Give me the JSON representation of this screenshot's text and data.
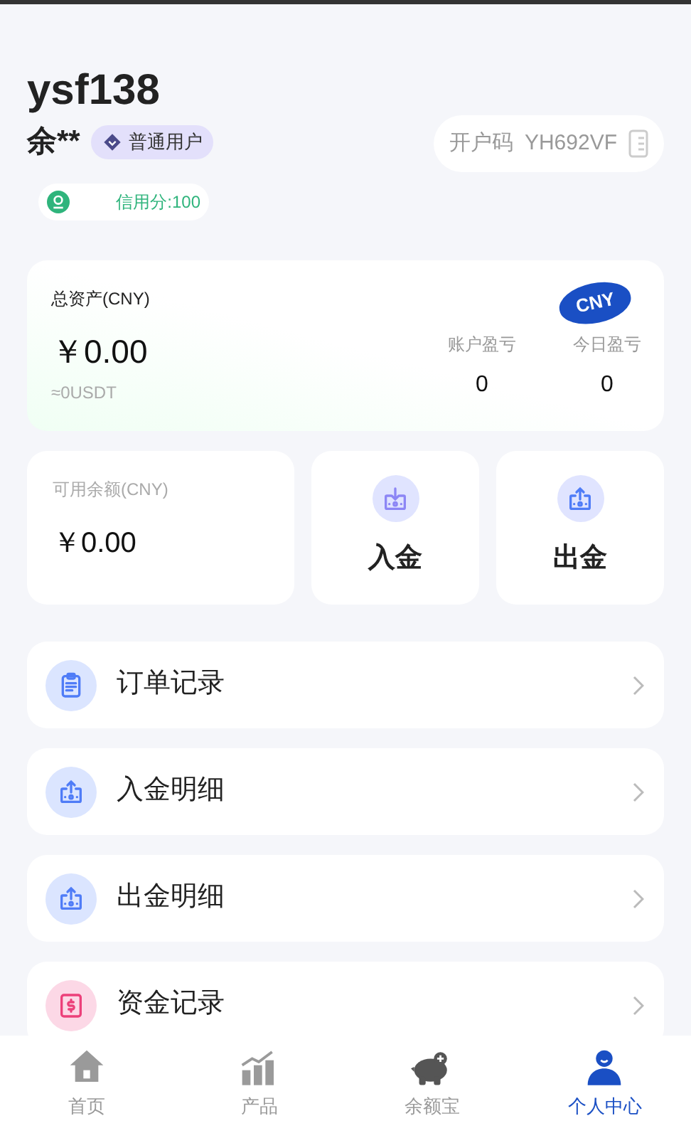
{
  "profile": {
    "username": "ysf138",
    "real_name": "余**",
    "level_badge": "普通用户",
    "invite": {
      "label": "开户码",
      "code": "YH692VF"
    },
    "credit": "信用分:100"
  },
  "assets": {
    "title": "总资产(CNY)",
    "currency_badge": "CNY",
    "amount": "￥0.00",
    "usdt": "≈0USDT",
    "stats": [
      {
        "label": "账户盈亏",
        "value": "0"
      },
      {
        "label": "今日盈亏",
        "value": "0"
      }
    ]
  },
  "balance": {
    "title": "可用余额(CNY)",
    "amount": "￥0.00"
  },
  "actions": [
    {
      "kind": "deposit",
      "label": "入金"
    },
    {
      "kind": "withdraw",
      "label": "出金"
    }
  ],
  "menu": [
    {
      "kind": "orders",
      "label": "订单记录"
    },
    {
      "kind": "withdraw",
      "label": "入金明细"
    },
    {
      "kind": "withdraw",
      "label": "出金明细"
    },
    {
      "kind": "funds",
      "label": "资金记录"
    }
  ],
  "tabbar": [
    {
      "kind": "home",
      "label": "首页",
      "selected": false
    },
    {
      "kind": "products",
      "label": "产品",
      "selected": false
    },
    {
      "kind": "piggy",
      "label": "余额宝",
      "selected": false
    },
    {
      "kind": "user",
      "label": "个人中心",
      "selected": true
    }
  ]
}
